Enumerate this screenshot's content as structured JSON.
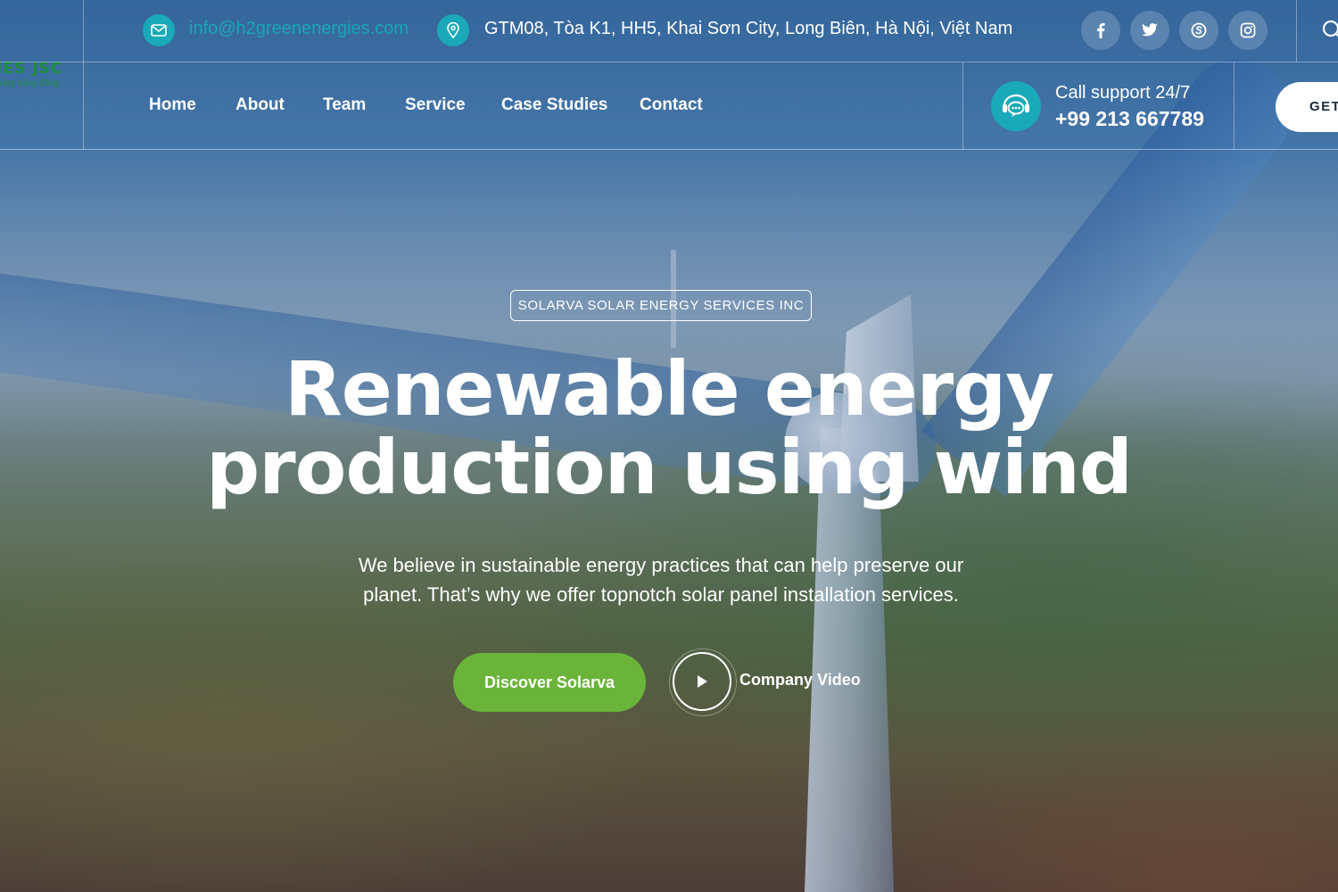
{
  "logo": {
    "name": "IES JSC",
    "tagline": "ùng cộng đồng"
  },
  "contact_bar": {
    "email": "info@h2greenenergies.com",
    "address": "GTM08, Tòa K1, HH5, Khai Sơn City, Long Biên, Hà Nội, Việt Nam",
    "email_icon": "mail-icon",
    "address_icon": "map-pin-icon",
    "social": [
      {
        "name": "facebook-icon",
        "glyph": "f"
      },
      {
        "name": "twitter-icon",
        "glyph": "🐦"
      },
      {
        "name": "skype-icon",
        "glyph": "S"
      },
      {
        "name": "instagram-icon",
        "glyph": "◎"
      }
    ]
  },
  "nav": {
    "items": [
      "Home",
      "About",
      "Team",
      "Service",
      "Case Studies",
      "Contact"
    ]
  },
  "support": {
    "label": "Call support 24/7",
    "phone": "+99 213 667789"
  },
  "cta_top": {
    "label": "GET"
  },
  "hero": {
    "badge": "SOLARVA SOLAR ENERGY SERVICES INC",
    "headline_line1": "Renewable energy",
    "headline_line2": "production using wind",
    "sub_line1": "We believe in sustainable energy practices that can help preserve our",
    "sub_line2": "planet. That’s why we offer topnotch solar panel installation services.",
    "primary_button": "Discover Solarva",
    "video_label": "Company Video"
  },
  "colors": {
    "accent_teal": "#1aa9b8",
    "accent_green": "#6ab43a",
    "logo_green": "#1e8c3a"
  }
}
